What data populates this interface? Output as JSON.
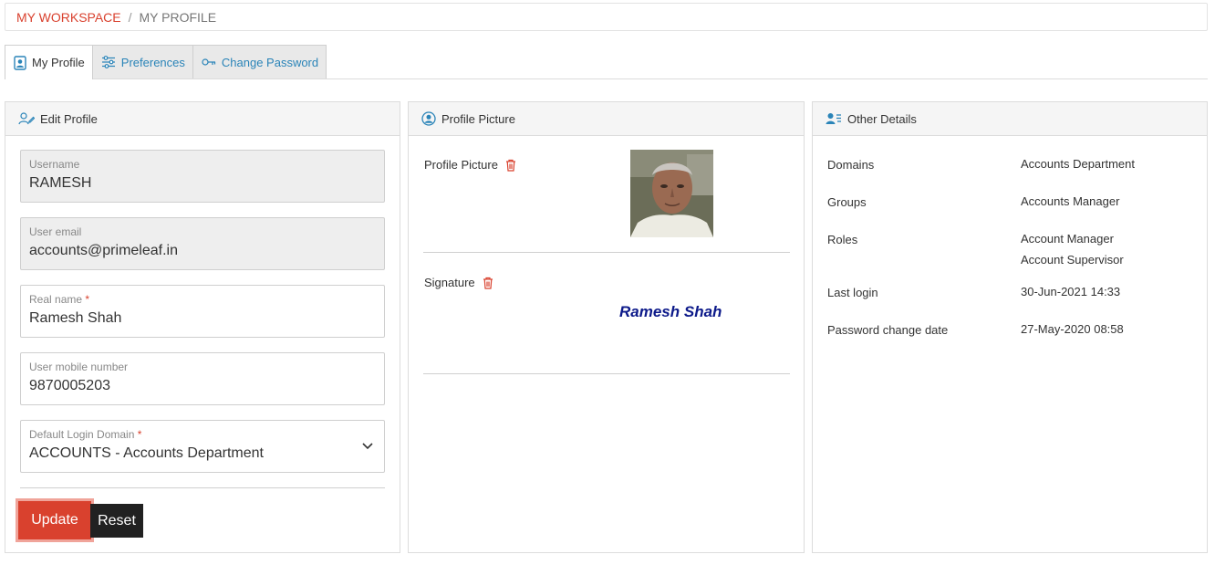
{
  "breadcrumb": {
    "home": "MY WORKSPACE",
    "separator": "/",
    "current": "MY PROFILE"
  },
  "tabs": [
    {
      "label": "My Profile",
      "icon": "profile-card-icon",
      "active": true
    },
    {
      "label": "Preferences",
      "icon": "sliders-icon",
      "active": false
    },
    {
      "label": "Change Password",
      "icon": "key-icon",
      "active": false
    }
  ],
  "edit_profile": {
    "title": "Edit Profile",
    "fields": {
      "username": {
        "label": "Username",
        "value": "RAMESH",
        "readonly": true
      },
      "email": {
        "label": "User email",
        "value": "accounts@primeleaf.in",
        "readonly": true
      },
      "real_name": {
        "label": "Real name",
        "required_mark": "*",
        "value": "Ramesh Shah"
      },
      "mobile": {
        "label": "User mobile number",
        "value": "9870005203"
      },
      "domain": {
        "label": "Default Login Domain",
        "required_mark": "*",
        "value": "ACCOUNTS - Accounts Department"
      }
    },
    "update_label": "Update",
    "reset_label": "Reset"
  },
  "profile_picture": {
    "title": "Profile Picture",
    "picture_label": "Profile Picture",
    "signature_label": "Signature",
    "signature_text": "Ramesh Shah"
  },
  "other_details": {
    "title": "Other Details",
    "rows": {
      "domains": {
        "label": "Domains",
        "value": "Accounts Department"
      },
      "groups": {
        "label": "Groups",
        "value": "Accounts Manager"
      },
      "roles": {
        "label": "Roles",
        "values": [
          "Account Manager",
          "Account Supervisor"
        ]
      },
      "last_login": {
        "label": "Last login",
        "value": "30-Jun-2021 14:33"
      },
      "password_change": {
        "label": "Password change date",
        "value": "27-May-2020 08:58"
      }
    }
  },
  "colors": {
    "accent": "#d9412e",
    "link": "#2a84b8",
    "dark_button": "#212121"
  }
}
